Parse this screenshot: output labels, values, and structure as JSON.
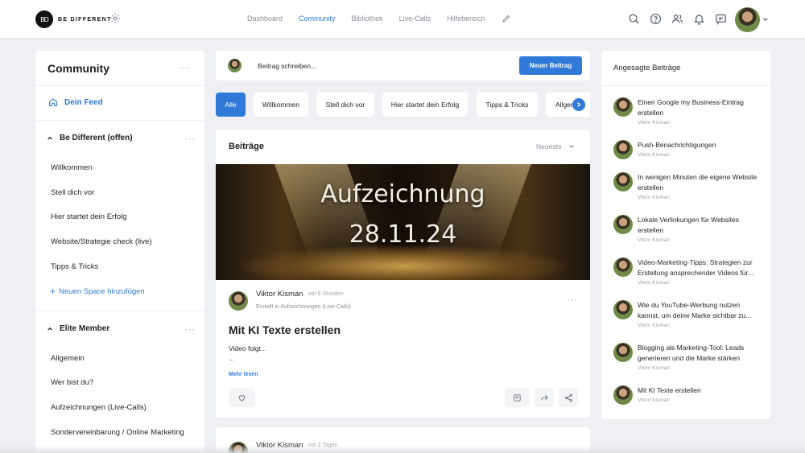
{
  "header": {
    "logo_mark": "BD",
    "logo_text": "BE DIFFERENT",
    "nav": [
      {
        "label": "Dashboard",
        "active": false
      },
      {
        "label": "Community",
        "active": true
      },
      {
        "label": "Bibliothek",
        "active": false
      },
      {
        "label": "Live-Calls",
        "active": false
      },
      {
        "label": "Hilfebereich",
        "active": false
      }
    ],
    "icons": [
      "search-icon",
      "help-icon",
      "users-icon",
      "bell-icon",
      "chat-icon"
    ],
    "accent": "#2f7ad8"
  },
  "sidebar": {
    "title": "Community",
    "dots": "···",
    "feed_label": "Dein Feed",
    "group1": {
      "title": "Be Different (offen)",
      "items": [
        "Willkommen",
        "Stell dich vor",
        "Hier startet dein Erfolg",
        "Website/Strategie check (live)",
        "Tipps & Tricks"
      ]
    },
    "add_space": "Neuen Space hinzufügen",
    "group2": {
      "title": "Elite Member",
      "items": [
        "Allgemein",
        "Wer bist du?",
        "Aufzeichnungen (Live-Calls)",
        "Sondervereinbarung / Online Marketing"
      ]
    }
  },
  "composer": {
    "placeholder": "Beitrag schreiben...",
    "button": "Neuer Beitrag"
  },
  "chips": [
    "Alle",
    "Willkommen",
    "Stell dich vor",
    "Hier startet dein Erfolg",
    "Tipps & Tricks",
    "Allgemein"
  ],
  "posts": {
    "heading": "Beiträge",
    "sort": "Neueste",
    "post1": {
      "banner_line1": "Aufzeichnung",
      "banner_line2": "28.11.24",
      "author": "Viktor Kisman",
      "time": "vor 8 Stunden",
      "created_in": "Erstellt in Aufzeichnungen (Live-Calls)",
      "title": "Mit KI Texte erstellen",
      "body": "Video folgt...",
      "ellipsis": "...",
      "read_more": "Mehr lesen"
    },
    "post2": {
      "author": "Viktor Kisman",
      "time": "vor 2 Tagen"
    }
  },
  "trending": {
    "heading": "Angesagte Beiträge",
    "items": [
      {
        "title": "Einen Google my Business-Eintrag erstellen",
        "author": "Viktor Kisman"
      },
      {
        "title": "Push-Benachrichtigungen",
        "author": "Viktor Kisman"
      },
      {
        "title": "In wenigen Minuten die eigene Website erstellen",
        "author": "Viktor Kisman"
      },
      {
        "title": "Lokale Verlinkungen für Websites erstellen",
        "author": "Viktor Kisman"
      },
      {
        "title": "Video-Marketing-Tipps: Strategien zur Erstellung ansprechender Videos für...",
        "author": "Viktor Kisman"
      },
      {
        "title": "Wie du YouTube-Werbung nutzen kannst, um deine Marke sichtbar zu...",
        "author": "Viktor Kisman"
      },
      {
        "title": "Blogging als Marketing-Tool: Leads generieren und die Marke stärken",
        "author": "Viktor Kisman"
      },
      {
        "title": "Mit KI Texte erstellen",
        "author": "Viktor Kisman"
      }
    ]
  }
}
